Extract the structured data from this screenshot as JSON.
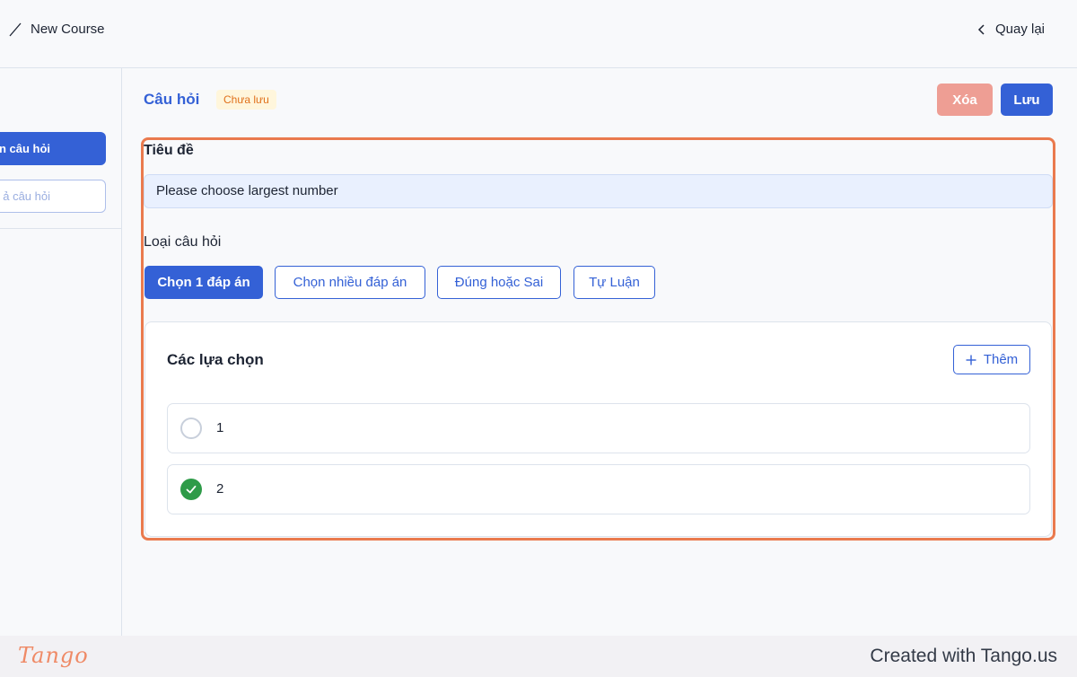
{
  "header": {
    "breadcrumb_title": "New Course",
    "back_label": "Quay lại"
  },
  "sidebar": {
    "items": [
      {
        "label": "n câu hỏi",
        "active": true
      },
      {
        "label": "ả câu hỏi",
        "active": false
      }
    ]
  },
  "main": {
    "section_title": "Câu hỏi",
    "status_badge": "Chưa lưu",
    "delete_label": "Xóa",
    "save_label": "Lưu",
    "title_label": "Tiêu đề",
    "title_value": "Please choose largest number",
    "type_label": "Loại câu hỏi",
    "question_types": [
      {
        "label": "Chọn 1 đáp án",
        "active": true
      },
      {
        "label": "Chọn nhiều đáp án",
        "active": false
      },
      {
        "label": "Đúng hoặc Sai",
        "active": false
      },
      {
        "label": "Tự Luận",
        "active": false
      }
    ],
    "choices": {
      "title": "Các lựa chọn",
      "add_label": "Thêm",
      "options": [
        {
          "label": "1",
          "correct": false
        },
        {
          "label": "2",
          "correct": true
        }
      ]
    }
  },
  "footer": {
    "logo_text": "Tango",
    "created_with": "Created with Tango.us"
  },
  "colors": {
    "primary": "#3461d6",
    "highlight": "#ea7a4e",
    "delete": "#ee9e94",
    "correct": "#2e9b48"
  }
}
